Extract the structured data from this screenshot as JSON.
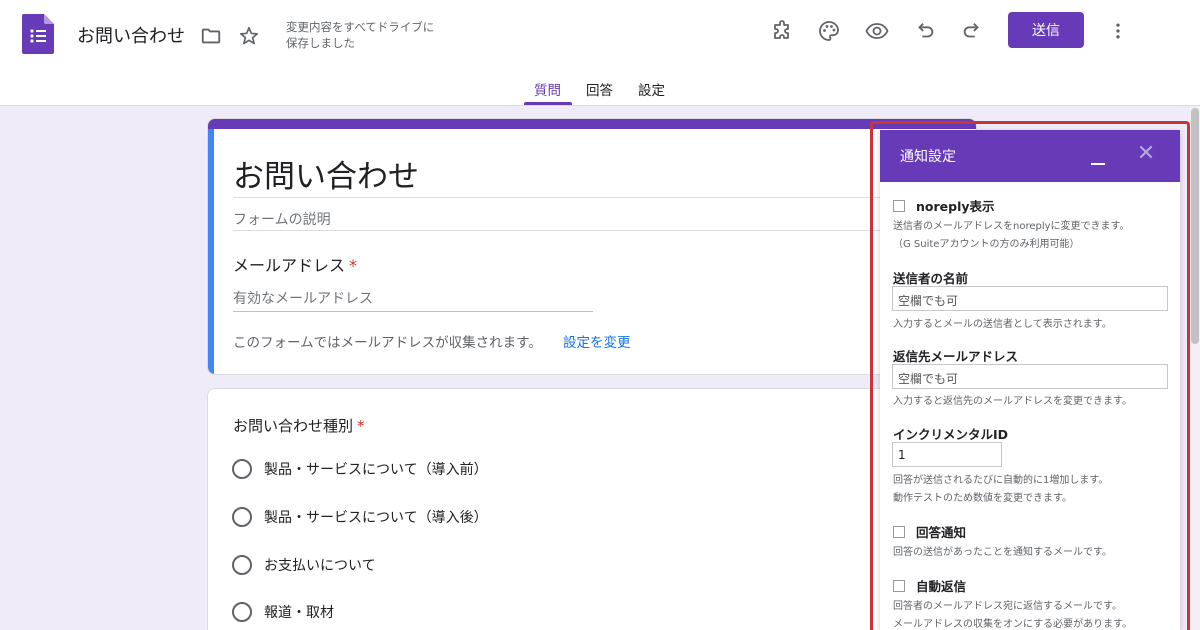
{
  "header": {
    "doc_title": "お問い合わせ",
    "saved_line1": "変更内容をすべてドライブに",
    "saved_line2": "保存しました",
    "send_label": "送信"
  },
  "tabs": [
    {
      "label": "質問",
      "active": true
    },
    {
      "label": "回答",
      "active": false
    },
    {
      "label": "設定",
      "active": false
    }
  ],
  "form": {
    "title": "お問い合わせ",
    "description_placeholder": "フォームの説明",
    "email_label": "メールアドレス",
    "required_mark": "*",
    "email_placeholder": "有効なメールアドレス",
    "collect_note": "このフォームではメールアドレスが収集されます。",
    "change_link": "設定を変更"
  },
  "question": {
    "title": "お問い合わせ種別",
    "required_mark": "*",
    "options": [
      "製品・サービスについて（導入前）",
      "製品・サービスについて（導入後）",
      "お支払いについて",
      "報道・取材"
    ]
  },
  "panel": {
    "title": "通知設定",
    "noreply": {
      "label": "noreply表示",
      "desc1": "送信者のメールアドレスをnoreplyに変更できます。",
      "desc2": "（G Suiteアカウントの方のみ利用可能）",
      "checked": false
    },
    "sender_name": {
      "label": "送信者の名前",
      "placeholder": "空欄でも可",
      "desc": "入力するとメールの送信者として表示されます。"
    },
    "reply_to": {
      "label": "返信先メールアドレス",
      "placeholder": "空欄でも可",
      "desc": "入力すると返信先のメールアドレスを変更できます。"
    },
    "incremental": {
      "label": "インクリメンタルID",
      "value": "1",
      "desc1": "回答が送信されるたびに自動的に1増加します。",
      "desc2": "動作テストのため数値を変更できます。"
    },
    "answer_notify": {
      "label": "回答通知",
      "desc": "回答の送信があったことを通知するメールです。",
      "checked": false
    },
    "auto_reply": {
      "label": "自動返信",
      "desc1": "回答者のメールアドレス宛に返信するメールです。",
      "desc2": "メールアドレスの収集をオンにする必要があります。",
      "checked": false
    }
  },
  "colors": {
    "accent": "#673ab7",
    "blue_bar": "#4285f4",
    "link": "#1a73e8",
    "highlight": "#c9343a",
    "background": "#f0ebf8"
  },
  "icons": [
    "forms-logo-icon",
    "folder-icon",
    "star-icon",
    "puzzle-icon",
    "palette-icon",
    "eye-icon",
    "undo-icon",
    "redo-icon",
    "more-vert-icon",
    "minimize-icon",
    "close-icon"
  ]
}
